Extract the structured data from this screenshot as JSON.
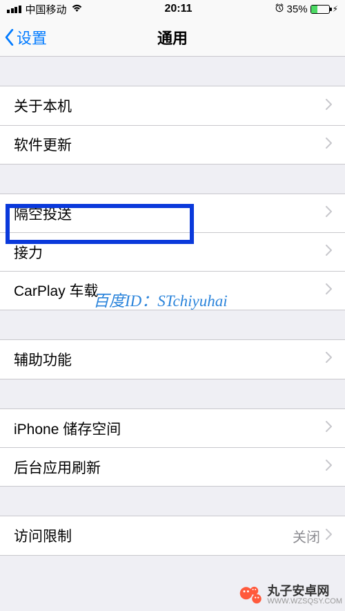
{
  "status": {
    "carrier": "中国移动",
    "time": "20:11",
    "battery_pct": "35%"
  },
  "navbar": {
    "back_label": "设置",
    "title": "通用"
  },
  "groups": [
    {
      "items": [
        {
          "key": "about",
          "label": "关于本机"
        },
        {
          "key": "software_update",
          "label": "软件更新"
        }
      ]
    },
    {
      "items": [
        {
          "key": "airdrop",
          "label": "隔空投送"
        },
        {
          "key": "handoff",
          "label": "接力"
        },
        {
          "key": "carplay",
          "label": "CarPlay 车载"
        }
      ]
    },
    {
      "items": [
        {
          "key": "accessibility",
          "label": "辅助功能"
        }
      ]
    },
    {
      "items": [
        {
          "key": "iphone_storage",
          "label": "iPhone 储存空间"
        },
        {
          "key": "background_refresh",
          "label": "后台应用刷新"
        }
      ]
    },
    {
      "items": [
        {
          "key": "restrictions",
          "label": "访问限制",
          "value": "关闭"
        }
      ]
    }
  ],
  "overlay": {
    "watermark_center": "百度ID：STchiyuhai",
    "wm_brand": "丸子安卓网",
    "wm_url": "WWW.WZSQSY.COM"
  }
}
